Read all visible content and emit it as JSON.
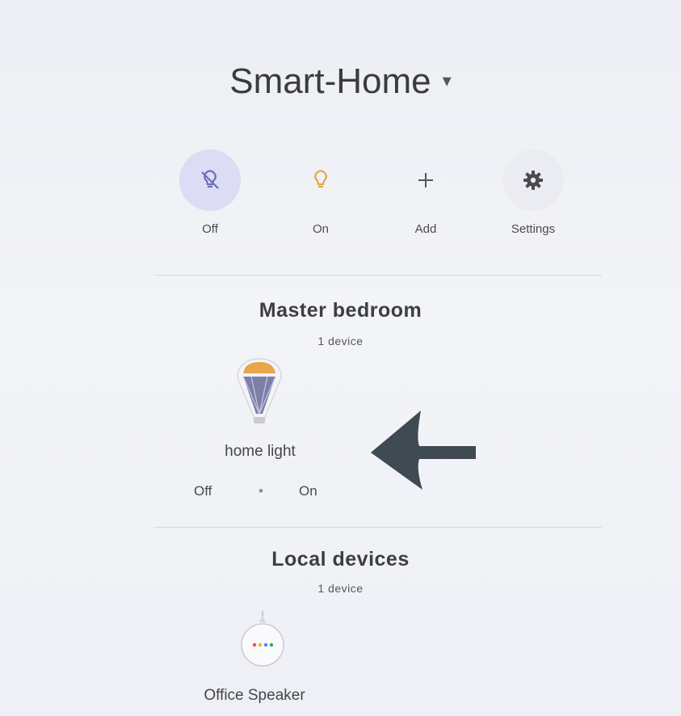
{
  "home": {
    "title": "Smart-Home",
    "caret": "▾"
  },
  "actions": [
    {
      "label": "Off",
      "icon": "light-off-icon"
    },
    {
      "label": "On",
      "icon": "lightbulb-icon"
    },
    {
      "label": "Add",
      "icon": "plus-icon"
    },
    {
      "label": "Settings",
      "icon": "gear-icon"
    }
  ],
  "rooms": [
    {
      "name": "Master bedroom",
      "count": "1 device",
      "devices": [
        {
          "name": "home light",
          "icon": "bulb-icon",
          "off_label": "Off",
          "separator": "•",
          "on_label": "On"
        }
      ]
    },
    {
      "name": "Local devices",
      "count": "1 device",
      "devices": [
        {
          "name": "Office Speaker",
          "icon": "speaker-icon"
        }
      ]
    }
  ],
  "colors": {
    "accent_circle": "#dcdcf4",
    "accent_icon": "#6b6fb5",
    "bulb_on": "#e8a54b",
    "arrow": "#3f4a52",
    "speaker_dots": [
      "#e8554e",
      "#f2b632",
      "#4a8af4",
      "#34a853"
    ]
  }
}
